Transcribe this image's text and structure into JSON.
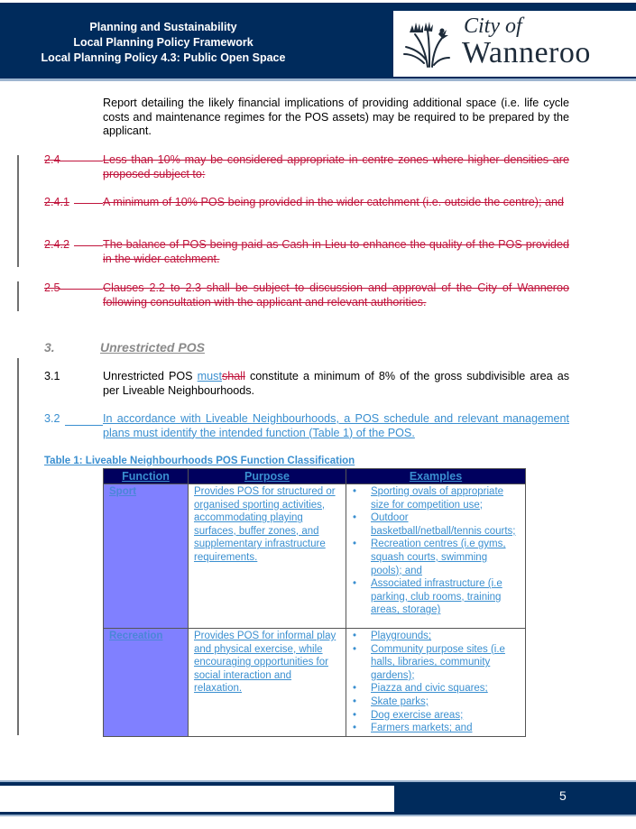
{
  "header": {
    "line1": "Planning and Sustainability",
    "line2": "Local Planning Policy Framework",
    "line3": "Local Planning Policy 4.3: Public Open Space",
    "logo": {
      "icon": "kangaroo-paw-icon",
      "text_line1": "City of",
      "text_line2": "Wanneroo"
    }
  },
  "colors": {
    "brand_navy": "#002b5c",
    "deleted_text": "#c0143c",
    "inserted_text": "#3a8fd0",
    "table_header_bg": "#00005e",
    "function_cell_bg": "#8080ff"
  },
  "body": {
    "intro_paragraph": "Report detailing the likely financial implications of providing additional space (i.e. life cycle costs and maintenance regimes for the POS assets) may be required to be prepared by the applicant.",
    "deleted_clauses": [
      {
        "num": "2.4",
        "text": "Less than 10% may be considered appropriate in centre zones where higher densities are proposed subject to:"
      },
      {
        "num": "2.4.1",
        "text": "A minimum of 10% POS being provided in the wider catchment (i.e. outside the centre); and"
      },
      {
        "num": "2.4.2",
        "text": "The balance of POS being paid as Cash-in-Lieu to enhance the quality of the POS provided in the wider catchment."
      },
      {
        "num": "2.5",
        "text": "Clauses 2.2 to 2.3 shall be subject to discussion and approval of the City of Wanneroo following consultation with the applicant and relevant authorities."
      }
    ],
    "section3": {
      "num": "3.",
      "title": "Unrestricted POS"
    },
    "clause_3_1": {
      "num": "3.1",
      "text_before": "Unrestricted POS ",
      "inserted_word": "must",
      "deleted_word": "shall",
      "text_after": " constitute a minimum of 8% of the gross subdivisible area as per Liveable Neighbourhoods."
    },
    "clause_3_2": {
      "num": "3.2",
      "text": "In accordance with Liveable Neighbourhoods, a POS schedule and relevant management plans must identify the intended function (Table 1) of the POS."
    }
  },
  "table": {
    "caption": "Table 1: Liveable Neighbourhoods POS Function Classification",
    "headers": [
      "Function",
      "Purpose",
      "Examples"
    ],
    "rows": [
      {
        "function": "Sport",
        "purpose": "Provides POS for structured or organised sporting activities, accommodating playing surfaces, buffer zones, and supplementary infrastructure requirements.",
        "examples": [
          "Sporting ovals of appropriate size for competition use;",
          "Outdoor basketball/netball/tennis courts;",
          "Recreation centres (i.e gyms, squash courts, swimming pools); and",
          "Associated infrastructure (i.e parking, club rooms, training areas, storage)"
        ]
      },
      {
        "function": "Recreation",
        "purpose": "Provides POS for informal play and physical exercise, while encouraging opportunities for social interaction and relaxation.",
        "examples": [
          "Playgrounds;",
          "Community purpose sites (i.e halls, libraries, community gardens);",
          "Piazza and civic squares;",
          "Skate parks;",
          "Dog exercise areas;",
          "Farmers markets; and"
        ]
      }
    ],
    "bullet": "•"
  },
  "footer": {
    "page_number": "5"
  }
}
